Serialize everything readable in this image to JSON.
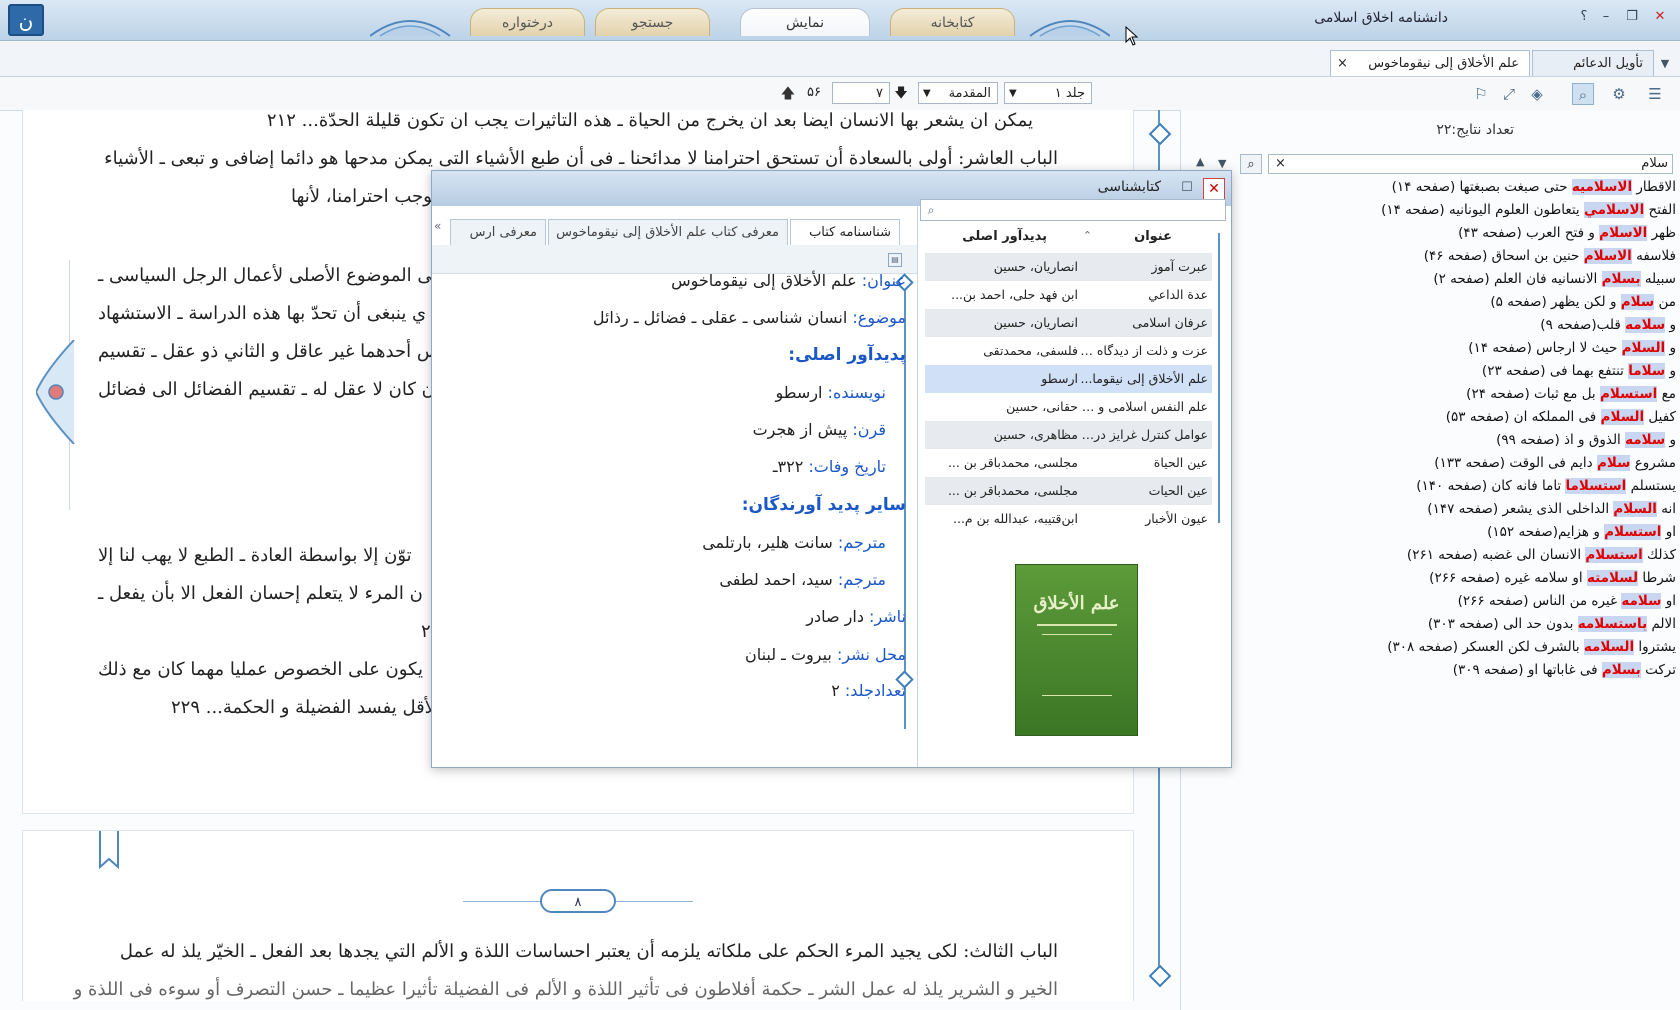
{
  "window": {
    "title": "دانشنامه اخلاق اسلامی",
    "top_tabs": [
      "کتابخانه",
      "نمایش",
      "جستجو",
      "درختواره"
    ],
    "active_tab": "نمایش",
    "buttons": {
      "help": "؟",
      "minimize": "–",
      "restore": "❐",
      "close": "✕"
    }
  },
  "doc_tabs": [
    {
      "label": "علم الأخلاق إلى نيقوماخوس",
      "active": true,
      "close": "×"
    },
    {
      "label": "تأويل الدعائم",
      "active": false
    }
  ],
  "toolbar": {
    "volume": "جلد ۱",
    "section": "المقدمة",
    "page": "۷",
    "total": "۵۶",
    "icons": [
      "menu-icon",
      "settings-icon",
      "search-icon",
      "layers-icon",
      "fullscreen-icon",
      "bookmark-icon"
    ]
  },
  "page_text": {
    "lines_top": [
      "يمكن ان يشعر بها الانسان ايضا بعد ان يخرج من الحياة ـ هذه التاثيرات يجب ان تكون قليلة الحدّة... ٢١٢",
      "الباب العاشر: أولى بالسعادة أن تستحق احترامنا لا مدائحنا ـ فى أن طبع الأشياء التى يمكن مدحها هو دائما إضافى و تبعى ـ الأشياء",
      "على اللذة ـ السعادة تستوجب احترامنا، لأنها"
    ],
    "lines_mid": [
      "هى الموضوع الأصلى لأعمال الرجل السياسى ـ",
      "ي ينبغى أن تحدّ بها هذه الدراسة ـ الاستشهاد",
      "س أحدهما غير عاقل و الثاني ذو عقل ـ تقسيم",
      "ن كان لا عقل له ـ تقسيم الفضائل الى فضائل"
    ],
    "lines_low": [
      "توّن إلا بواسطة العادة ـ الطبع لا يهب لنا إلا",
      "ن المرء لا يتعلم إحسان الفعل الا بأن يفعل ـ",
      "٢",
      "يكون على الخصوص عمليا مهما كان مع ذلك",
      "بالأقل يفسد الفضيلة و الحكمة... ٢٢٩"
    ],
    "page_number": "٨",
    "lines_page2": [
      "الباب الثالث: لكى يجيد المرء الحكم على ملكاته يلزمه أن يعتبر احساسات اللذة و الألم التي يجدها بعد الفعل ـ الخيّر يلذ له عمل",
      "الخير و الشرير يلذ له عمل الشر ـ حكمة أفلاطون فى تأثير اللذة و الألم فى الفضيلة تأثيرا عظيما ـ حسن التصرف أو سوءه فى اللذة و"
    ]
  },
  "search_panel": {
    "result_count": "تعداد نتايج:۲۲",
    "query": "سلام",
    "clear": "×",
    "results": [
      {
        "pre": "الاقطار ",
        "hit": "الاسلاميه",
        "post": " حتى صبغت بصبغتها (صفحه ١۴)"
      },
      {
        "pre": "الفتح ",
        "hit": "الاسلامي",
        "post": " يتعاطون العلوم اليونانيه (صفحه ١۴)"
      },
      {
        "pre": "ظهر ",
        "hit": "الاسلام",
        "post": " و فتح العرب (صفحه ۴٣)"
      },
      {
        "pre": "فلاسفه ",
        "hit": "الاسلام",
        "post": " حنين بن اسحاق (صفحه ۴۶)"
      },
      {
        "pre": "سبيله ",
        "hit": "بسلام",
        "post": " الانسانيه فان العلم (صفحه ٢)"
      },
      {
        "pre": "من ",
        "hit": "سلام",
        "post": " و لكن يظهر (صفحه ۵)"
      },
      {
        "pre": "و ",
        "hit": "سلامه",
        "post": " قلب(صفحه ٩)"
      },
      {
        "pre": "و ",
        "hit": "السلام",
        "post": " حيث لا ارجاس (صفحه ١۴)"
      },
      {
        "pre": "و ",
        "hit": "سلاما",
        "post": " تنتفع بهما فى (صفحه ٢٣)"
      },
      {
        "pre": "مع ",
        "hit": "استسلام",
        "post": " بل مع ثبات (صفحه ٢۴)"
      },
      {
        "pre": "كفيل ",
        "hit": "السلام",
        "post": " فى المملكه ان (صفحه ۵٣)"
      },
      {
        "pre": "و ",
        "hit": "سلامه",
        "post": " الذوق و اذ (صفحه ٩٩)"
      },
      {
        "pre": "مشروع ",
        "hit": "سلام",
        "post": " دايم فى الوقت (صفحه ١٣٣)"
      },
      {
        "pre": "يستسلم ",
        "hit": "استسلاما",
        "post": " تاما فانه كان (صفحه ١۴٠)"
      },
      {
        "pre": "انه ",
        "hit": "السلام",
        "post": " الداخلى الذى يشعر (صفحه ١۴٧)"
      },
      {
        "pre": "او ",
        "hit": "استسلام",
        "post": " و هزايم(صفحه ١۵٢)"
      },
      {
        "pre": "كذلك ",
        "hit": "استسلام",
        "post": " الانسان الى غضبه (صفحه ٢۶١)"
      },
      {
        "pre": "شرطا ",
        "hit": "لسلامته",
        "post": " او سلامه غيره (صفحه ٢۶۶)"
      },
      {
        "pre": "او ",
        "hit": "سلامه",
        "post": " غيره من الناس (صفحه ٢۶۶)"
      },
      {
        "pre": "الالم ",
        "hit": "باستسلامه",
        "post": " بدون حد الى (صفحه ٣٠٣)"
      },
      {
        "pre": "يشتروا ",
        "hit": "السلامه",
        "post": " بالشرف لكن العسكر (صفحه ٣٠٨)"
      },
      {
        "pre": "تركت ",
        "hit": "بسلام",
        "post": " فى غاباتها او (صفحه ٣٠٩)"
      }
    ]
  },
  "dialog": {
    "title": "كتابشناسی",
    "close": "✕",
    "maximize": "☐",
    "tabs": [
      "شناسنامه كتاب",
      "معرفی كتاب علم الأخلاق إلى نيقوماخوس",
      "معرفی ارس"
    ],
    "more": "«",
    "fields": {
      "title_label": "عنوان:",
      "title_value": "علم الأخلاق إلى نيقوماخوس",
      "subject_label": "موضوع:",
      "subject_value": "انسان شناسی ـ عقلی ـ فضائل ـ رذائل",
      "author_heading": "پديدآور اصلی:",
      "writer_label": "نويسنده:",
      "writer_value": "ارسطو",
      "century_label": "قرن:",
      "century_value": "پيش از هجرت",
      "death_label": "تاريخ وفات:",
      "death_value": "٣٢٢ـ",
      "others_heading": "ساير پديد آورندگان:",
      "tr1_label": "مترجم:",
      "tr1_value": "سانت هلير، بارتلمی",
      "tr2_label": "مترجم:",
      "tr2_value": "سيد، احمد لطفی",
      "publisher_label": "ناشر:",
      "publisher_value": "دار صادر",
      "place_label": "محل نشر:",
      "place_value": "بيروت ـ لبنان",
      "volumes_label": "تعدادجلد:",
      "volumes_value": "٢"
    },
    "list": {
      "col_title": "عنوان",
      "col_author": "پديدآور اصلی",
      "rows": [
        {
          "title": "عبرت آموز",
          "author": "انصاريان، حسين"
        },
        {
          "title": "عدة الداعي",
          "author": "ابن فهد حلی، احمد بن..."
        },
        {
          "title": "عرفان اسلامی",
          "author": "انصاريان، حسين"
        },
        {
          "title": "عزت و ذلت از ديدگاه ن...",
          "author": "فلسفی، محمدتقی"
        },
        {
          "title": "علم الأخلاق إلى نيقوما...",
          "author": "ارسطو"
        },
        {
          "title": "علم النفس اسلامی و ب...",
          "author": "حقانی، حسين"
        },
        {
          "title": "عوامل كنترل غرايز در ز...",
          "author": "مظاهری، حسين"
        },
        {
          "title": "عين الحياة",
          "author": "مجلسی، محمدباقر بن ..."
        },
        {
          "title": "عين الحيات",
          "author": "مجلسی، محمدباقر بن ..."
        },
        {
          "title": "عيون الأخبار",
          "author": "ابن‌قتيبه، عبدالله بن م..."
        }
      ],
      "selected_index": 4
    },
    "cover_text": "علم الأخلاق"
  }
}
